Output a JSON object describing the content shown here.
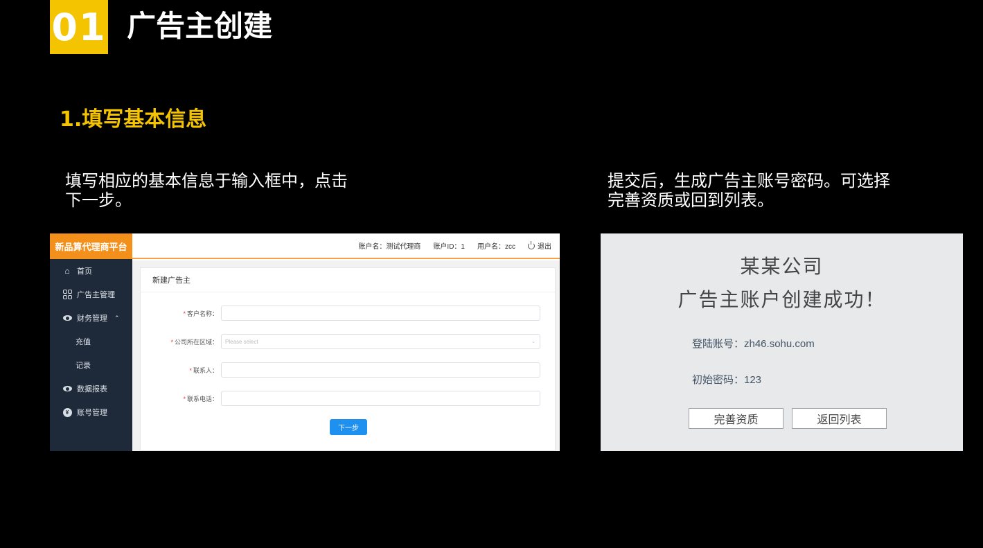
{
  "slide": {
    "number": "01",
    "title": "广告主创建",
    "step_title": "1.填写基本信息",
    "desc_left": "填写相应的基本信息于输入框中，点击下一步。",
    "desc_right": "提交后，生成广告主账号密码。可选择完善资质或回到列表。"
  },
  "app": {
    "logo": "新品算代理商平台",
    "topbar": {
      "account_name": "账户名：测试代理商",
      "account_id": "账户ID：1",
      "username": "用户名：zcc",
      "logout": "退出"
    },
    "sidebar": {
      "home": "首页",
      "advertiser_mgmt": "广告主管理",
      "finance_mgmt": "财务管理",
      "recharge": "充值",
      "records": "记录",
      "data_reports": "数据报表",
      "account_mgmt": "账号管理"
    },
    "form": {
      "card_title": "新建广告主",
      "required_mark": "*",
      "customer_name_label": "客户名称：",
      "region_label": "公司所在区域：",
      "region_placeholder": "Please select",
      "contact_label": "联系人：",
      "phone_label": "联系电话：",
      "next_button": "下一步"
    }
  },
  "result": {
    "company": "某某公司",
    "success_message": "广告主账户创建成功！",
    "login_account": "登陆账号：zh46.sohu.com",
    "initial_password": "初始密码：123",
    "complete_button": "完善资质",
    "back_button": "返回列表"
  },
  "colors": {
    "accent_yellow": "#f5c400",
    "logo_orange": "#f38f1b",
    "sidebar_bg": "#1e2a3a",
    "primary_blue": "#1e90f0"
  }
}
